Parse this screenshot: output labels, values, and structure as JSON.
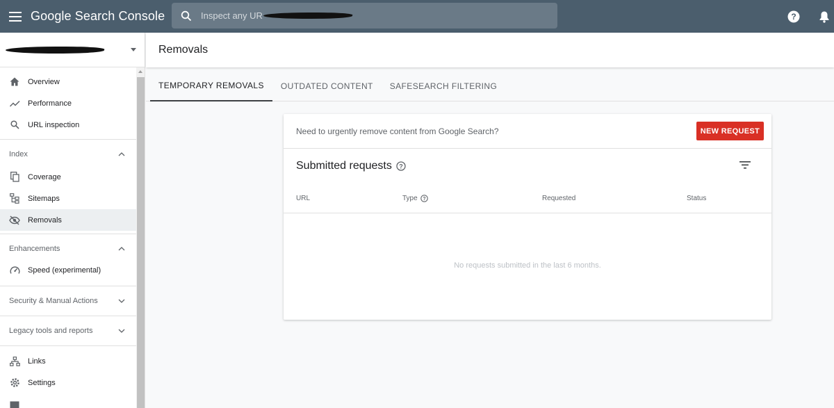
{
  "header": {
    "app_title": "Google Search Console",
    "search_placeholder": "Inspect any URL in \""
  },
  "sidebar": {
    "items_top": [
      {
        "label": "Overview",
        "icon": "home-icon"
      },
      {
        "label": "Performance",
        "icon": "trending-up-icon"
      },
      {
        "label": "URL inspection",
        "icon": "search-icon"
      }
    ],
    "index": {
      "title": "Index",
      "items": [
        {
          "label": "Coverage",
          "icon": "copy-icon"
        },
        {
          "label": "Sitemaps",
          "icon": "sitemap-icon"
        },
        {
          "label": "Removals",
          "icon": "eye-off-icon"
        }
      ]
    },
    "enhancements": {
      "title": "Enhancements",
      "items": [
        {
          "label": "Speed (experimental)",
          "icon": "speedometer-icon"
        }
      ]
    },
    "security": {
      "title": "Security & Manual Actions"
    },
    "legacy": {
      "title": "Legacy tools and reports"
    },
    "items_bottom": [
      {
        "label": "Links",
        "icon": "links-icon"
      },
      {
        "label": "Settings",
        "icon": "gear-icon"
      }
    ]
  },
  "page": {
    "title": "Removals",
    "tabs": [
      "TEMPORARY REMOVALS",
      "OUTDATED CONTENT",
      "SAFESEARCH FILTERING"
    ]
  },
  "card": {
    "prompt": "Need to urgently remove content from Google Search?",
    "new_request_label": "NEW REQUEST",
    "heading": "Submitted requests",
    "columns": [
      "URL",
      "Type",
      "Requested",
      "Status"
    ],
    "empty_message": "No requests submitted in the last 6 months."
  },
  "colors": {
    "topbar": "#4b5e6d",
    "accent_red": "#d93025"
  }
}
